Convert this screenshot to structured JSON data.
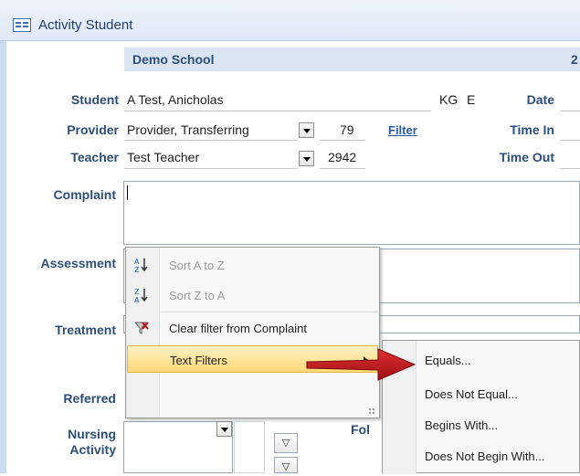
{
  "window": {
    "title": "Activity Student"
  },
  "header": {
    "school": "Demo School",
    "number_partial": "2"
  },
  "fields": {
    "student": {
      "label": "Student",
      "value": "A Test, Anicholas",
      "grade": "KG",
      "code": "E"
    },
    "date": {
      "label": "Date"
    },
    "provider": {
      "label": "Provider",
      "value": "Provider, Transferring",
      "number": "79",
      "filter_link": "Filter"
    },
    "time_in": {
      "label": "Time In"
    },
    "teacher": {
      "label": "Teacher",
      "value": "Test Teacher",
      "number": "2942"
    },
    "time_out": {
      "label": "Time Out"
    },
    "complaint": {
      "label": "Complaint",
      "value": ""
    },
    "assessment": {
      "label": "Assessment"
    },
    "treatment": {
      "label": "Treatment"
    },
    "referred": {
      "label": "Referred"
    },
    "nursing_activity": {
      "label_line1": "Nursing",
      "label_line2": "Activity"
    },
    "follow_partial": {
      "label": "Fol"
    }
  },
  "context_menu": {
    "items": [
      {
        "label": "Sort A to Z",
        "icon": "sort-az-icon",
        "enabled": false
      },
      {
        "label": "Sort Z to A",
        "icon": "sort-za-icon",
        "enabled": false
      },
      {
        "label": "Clear filter from Complaint",
        "icon": "clear-filter-icon",
        "enabled": true
      },
      {
        "label": "Text Filters",
        "icon": "",
        "enabled": true,
        "highlighted": true,
        "has_submenu": true
      }
    ]
  },
  "submenu": {
    "items": [
      {
        "label": "Equals..."
      },
      {
        "label": "Does Not Equal..."
      },
      {
        "label": "Begins With..."
      },
      {
        "label": "Does Not Begin With..."
      }
    ]
  },
  "colors": {
    "label_blue": "#2d4e78",
    "header_band": "#dbe5f1",
    "highlight": "#ffd978",
    "arrow_red": "#c0141a"
  }
}
